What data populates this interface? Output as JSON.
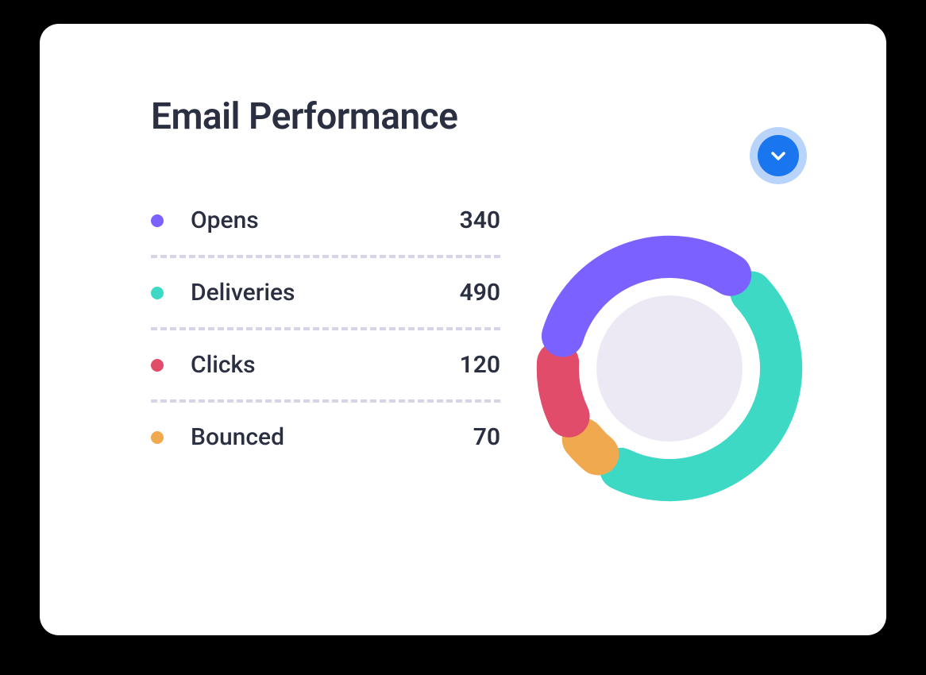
{
  "title": "Email Performance",
  "legend": [
    {
      "label": "Opens",
      "value": "340",
      "color": "#7b61ff"
    },
    {
      "label": "Deliveries",
      "value": "490",
      "color": "#3ed9c4"
    },
    {
      "label": "Clicks",
      "value": "120",
      "color": "#e24c6b"
    },
    {
      "label": "Bounced",
      "value": "70",
      "color": "#f0a94e"
    }
  ],
  "chart_data": {
    "type": "pie",
    "title": "Email Performance",
    "categories": [
      "Opens",
      "Deliveries",
      "Clicks",
      "Bounced"
    ],
    "values": [
      340,
      490,
      120,
      70
    ],
    "colors": [
      "#7b61ff",
      "#3ed9c4",
      "#e24c6b",
      "#f0a94e"
    ],
    "inner_radius_fraction": 0.55
  }
}
